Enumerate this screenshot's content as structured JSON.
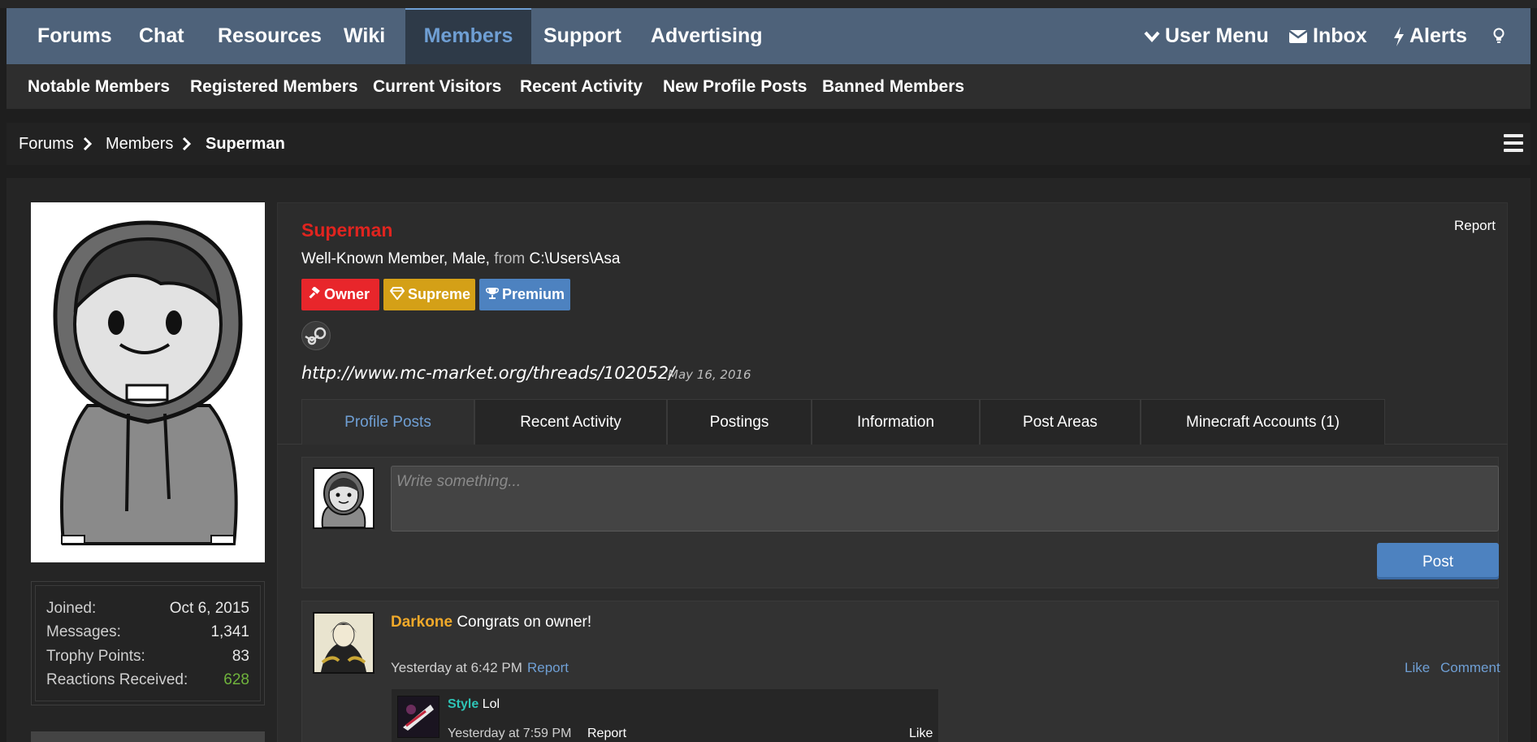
{
  "nav": {
    "tabs": [
      "Forums",
      "Chat",
      "Resources",
      "Wiki",
      "Members",
      "Support",
      "Advertising"
    ],
    "active_tab": "Members",
    "user_menu": "User Menu",
    "inbox": "Inbox",
    "alerts": "Alerts"
  },
  "subnav": [
    "Notable Members",
    "Registered Members",
    "Current Visitors",
    "Recent Activity",
    "New Profile Posts",
    "Banned Members"
  ],
  "breadcrumb": [
    "Forums",
    "Members",
    "Superman"
  ],
  "profile": {
    "username": "Superman",
    "title_text": "Well-Known Member, Male,",
    "from_label": "from",
    "location": "C:\\Users\\Asa",
    "report": "Report",
    "badges": [
      {
        "label": "Owner",
        "color": "#e8262b",
        "icon": "gavel-icon"
      },
      {
        "label": "Supreme",
        "color": "#d4a017",
        "icon": "diamond-icon"
      },
      {
        "label": "Premium",
        "color": "#4d82c0",
        "icon": "trophy-icon"
      }
    ],
    "status": "http://www.mc-market.org/threads/102052/",
    "status_date": "May 16, 2016"
  },
  "stats": {
    "joined_label": "Joined:",
    "joined": "Oct 6, 2015",
    "messages_label": "Messages:",
    "messages": "1,341",
    "trophy_label": "Trophy Points:",
    "trophy": "83",
    "reactions_label": "Reactions Received:",
    "reactions": "628"
  },
  "tabs": [
    "Profile Posts",
    "Recent Activity",
    "Postings",
    "Information",
    "Post Areas",
    "Minecraft Accounts (1)"
  ],
  "composer": {
    "placeholder": "Write something...",
    "post_button": "Post"
  },
  "post": {
    "author": "Darkone",
    "text": "Congrats on owner!",
    "time": "Yesterday at 6:42 PM",
    "report": "Report",
    "like": "Like",
    "comment": "Comment",
    "reply": {
      "author": "Style",
      "text": "Lol",
      "time": "Yesterday at 7:59 PM",
      "report": "Report",
      "like": "Like"
    }
  }
}
